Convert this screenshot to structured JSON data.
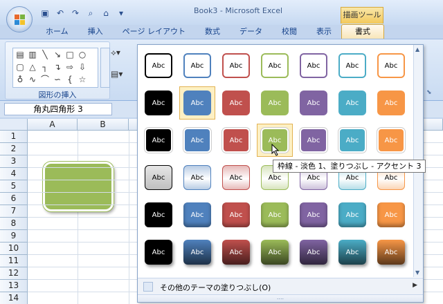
{
  "window": {
    "title": "Book3 - Microsoft Excel",
    "tool_context": "描画ツール"
  },
  "quick_access": [
    "save-icon",
    "undo-icon",
    "redo-icon",
    "print-preview-icon",
    "open-icon",
    "customize-icon"
  ],
  "ribbon": {
    "tabs": [
      "ホーム",
      "挿入",
      "ページ レイアウト",
      "数式",
      "データ",
      "校閲",
      "表示"
    ],
    "active_tab": "書式",
    "group_label": "図形の挿入"
  },
  "formula_bar": {
    "name_box": "角丸四角形 3"
  },
  "sheet": {
    "columns": [
      "A",
      "B"
    ],
    "rows": [
      "1",
      "2",
      "3",
      "4",
      "5",
      "6",
      "7",
      "8",
      "9",
      "10",
      "11",
      "12",
      "13",
      "14"
    ],
    "shape_fill": "#9bbb59"
  },
  "gallery": {
    "swatch_label": "Abc",
    "theme_colors": [
      "#000000",
      "#4f81bd",
      "#c0504d",
      "#9bbb59",
      "#8064a2",
      "#4bacc6",
      "#f79646"
    ],
    "light_colors": [
      "#bfbfbf",
      "#b8cce4",
      "#e6b9b8",
      "#d7e4bd",
      "#ccc1da",
      "#b7dee8",
      "#fbd5b5"
    ],
    "rows": 6,
    "footer_label": "その他のテーマの塗りつぶし(O)",
    "tooltip": "枠線 - 淡色 1、塗りつぶし - アクセント 3",
    "resize_grip": "...."
  }
}
